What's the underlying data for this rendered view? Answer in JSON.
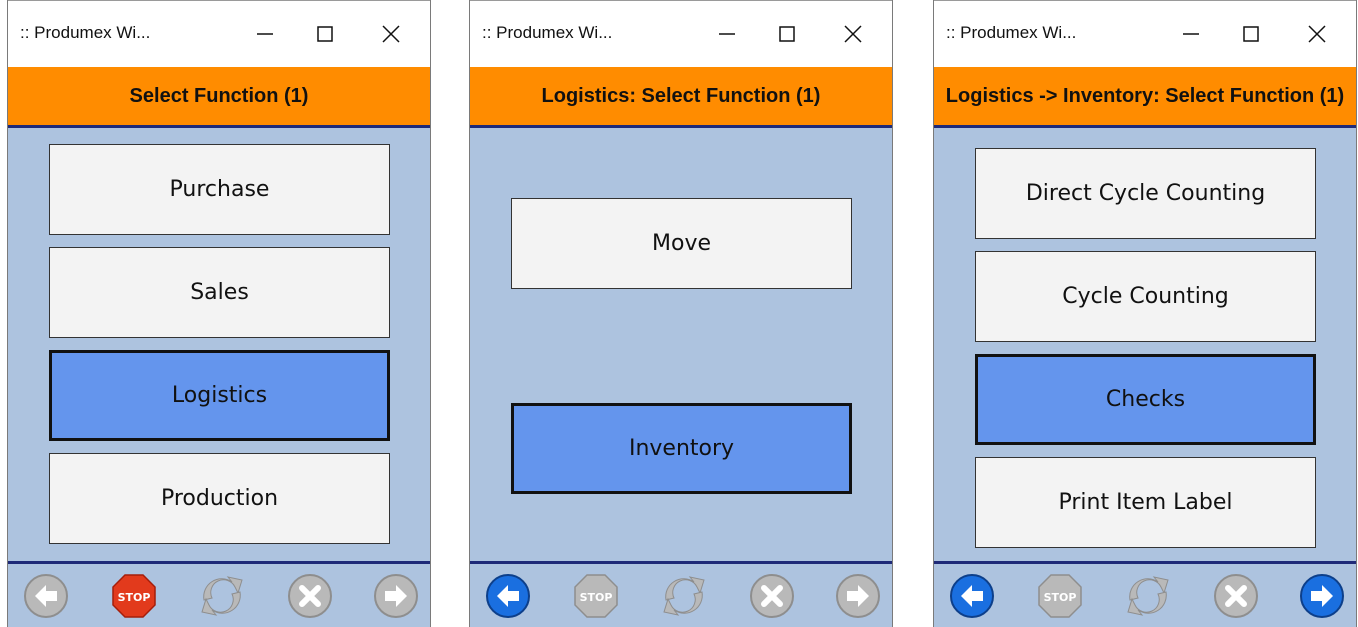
{
  "panels": [
    {
      "window_title": ":: Produmex Wi...",
      "header": "Select Function (1)",
      "buttons": [
        "Purchase",
        "Sales",
        "Logistics",
        "Production"
      ],
      "selected": "Logistics",
      "toolbar": {
        "back": "disabled",
        "stop": "enabled",
        "refresh": "disabled",
        "cancel": "disabled",
        "next": "disabled"
      },
      "stop_label": "STOP"
    },
    {
      "window_title": ":: Produmex Wi...",
      "header": "Logistics: Select Function (1)",
      "buttons": [
        "Move",
        "Inventory"
      ],
      "selected": "Inventory",
      "toolbar": {
        "back": "enabled",
        "stop": "disabled",
        "refresh": "disabled",
        "cancel": "disabled",
        "next": "disabled"
      },
      "stop_label": "STOP"
    },
    {
      "window_title": ":: Produmex Wi...",
      "header": "Logistics -> Inventory: Select Function (1)",
      "buttons": [
        "Direct Cycle Counting",
        "Cycle Counting",
        "Checks",
        "Print Item Label"
      ],
      "selected": "Checks",
      "toolbar": {
        "back": "enabled",
        "stop": "disabled",
        "refresh": "disabled",
        "cancel": "disabled",
        "next": "enabled"
      },
      "stop_label": "STOP"
    }
  ],
  "colors": {
    "header": "#ff8c00",
    "body": "#adc3df",
    "selected": "#6495ed",
    "accent_blue": "#1a6fe0",
    "disabled": "#b9b9b9",
    "stop_red": "#e23a1c"
  }
}
